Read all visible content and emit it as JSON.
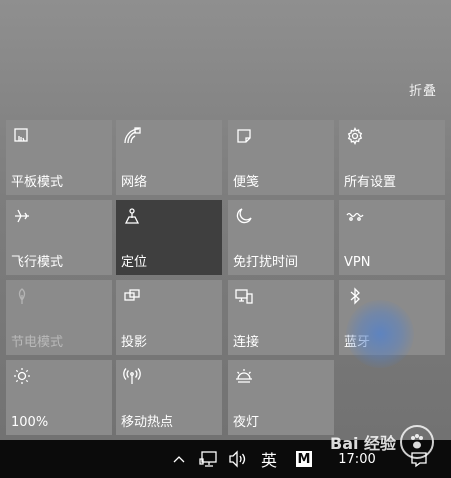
{
  "action_center": {
    "collapse_label": "折叠",
    "tiles": [
      {
        "label": "平板模式",
        "icon": "tablet-mode-icon"
      },
      {
        "label": "网络",
        "icon": "network-icon"
      },
      {
        "label": "便笺",
        "icon": "sticky-note-icon"
      },
      {
        "label": "所有设置",
        "icon": "gear-icon"
      },
      {
        "label": "飞行模式",
        "icon": "airplane-icon"
      },
      {
        "label": "定位",
        "icon": "location-icon"
      },
      {
        "label": "免打扰时间",
        "icon": "moon-icon"
      },
      {
        "label": "VPN",
        "icon": "vpn-icon"
      },
      {
        "label": "节电模式",
        "icon": "leaf-icon"
      },
      {
        "label": "投影",
        "icon": "project-icon"
      },
      {
        "label": "连接",
        "icon": "connect-icon"
      },
      {
        "label": "蓝牙",
        "icon": "bluetooth-icon"
      },
      {
        "label": "100%",
        "icon": "brightness-icon"
      },
      {
        "label": "移动热点",
        "icon": "hotspot-icon"
      },
      {
        "label": "夜灯",
        "icon": "night-light-icon"
      }
    ]
  },
  "taskbar": {
    "ime_label": "英",
    "app_letter": "M",
    "clock": "17:00"
  },
  "watermark": {
    "text": "Bai 经验"
  }
}
